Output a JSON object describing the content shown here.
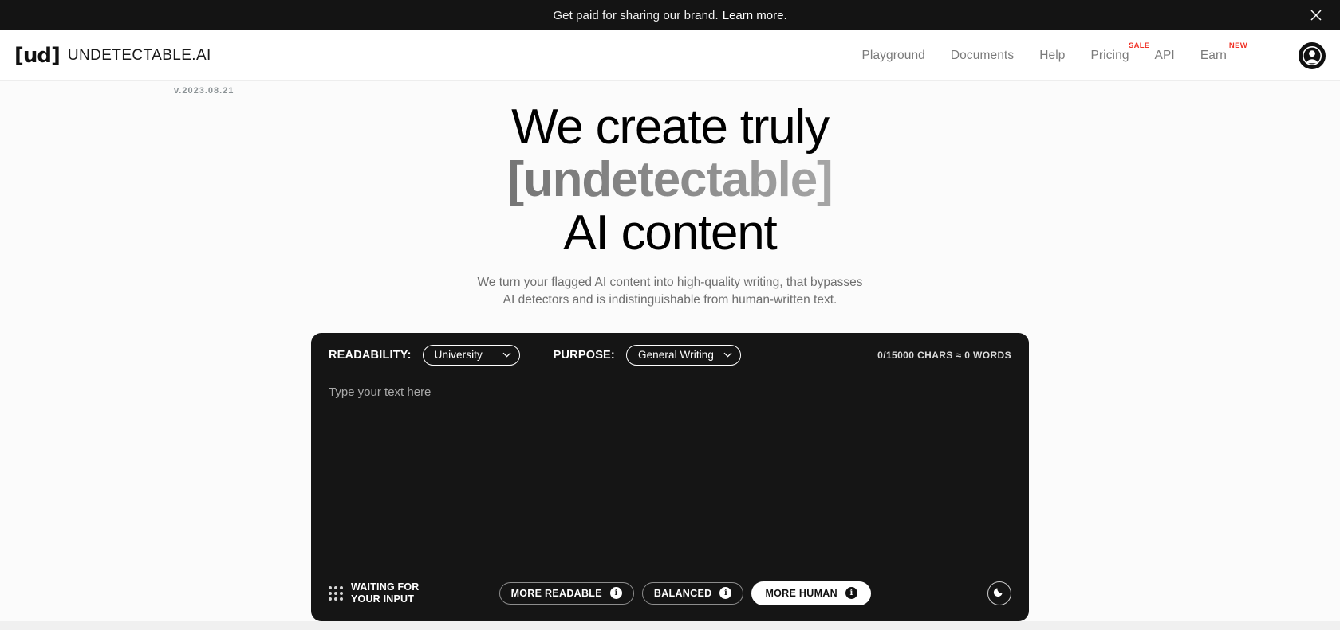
{
  "banner": {
    "text": "Get paid for sharing our brand.",
    "link_label": "Learn more.",
    "close_icon": "close-icon"
  },
  "header": {
    "logo_mark": "[ud]",
    "logo_name": "UNDETECTABLE.AI",
    "nav": [
      {
        "label": "Playground",
        "badge": ""
      },
      {
        "label": "Documents",
        "badge": ""
      },
      {
        "label": "Help",
        "badge": ""
      },
      {
        "label": "Pricing",
        "badge": "SALE"
      },
      {
        "label": "API",
        "badge": ""
      },
      {
        "label": "Earn",
        "badge": "NEW"
      }
    ],
    "avatar_icon": "user-avatar-icon"
  },
  "version": "v.2023.08.21",
  "hero": {
    "line1": "We create truly",
    "line2": "[undetectable]",
    "line3": "AI content",
    "subtitle_line1": "We turn your flagged AI content into high-quality writing, that bypasses",
    "subtitle_line2": "AI detectors and is indistinguishable from human-written text."
  },
  "editor": {
    "readability_label": "READABILITY:",
    "readability_value": "University",
    "purpose_label": "PURPOSE:",
    "purpose_value": "General Writing",
    "char_count": "0/15000 CHARS ≈ 0 WORDS",
    "input_value": "",
    "input_placeholder": "Type your text here",
    "status_line1": "WAITING FOR",
    "status_line2": "YOUR INPUT",
    "modes": [
      {
        "label": "MORE READABLE",
        "active": false
      },
      {
        "label": "BALANCED",
        "active": false
      },
      {
        "label": "MORE HUMAN",
        "active": true
      }
    ],
    "theme_toggle_icon": "moon-icon"
  },
  "colors": {
    "panel_bg": "#151515",
    "banner_bg": "#141414",
    "page_bg": "#fbfbfb",
    "badge_red": "#f03226",
    "muted_text": "#7b7b7b"
  }
}
